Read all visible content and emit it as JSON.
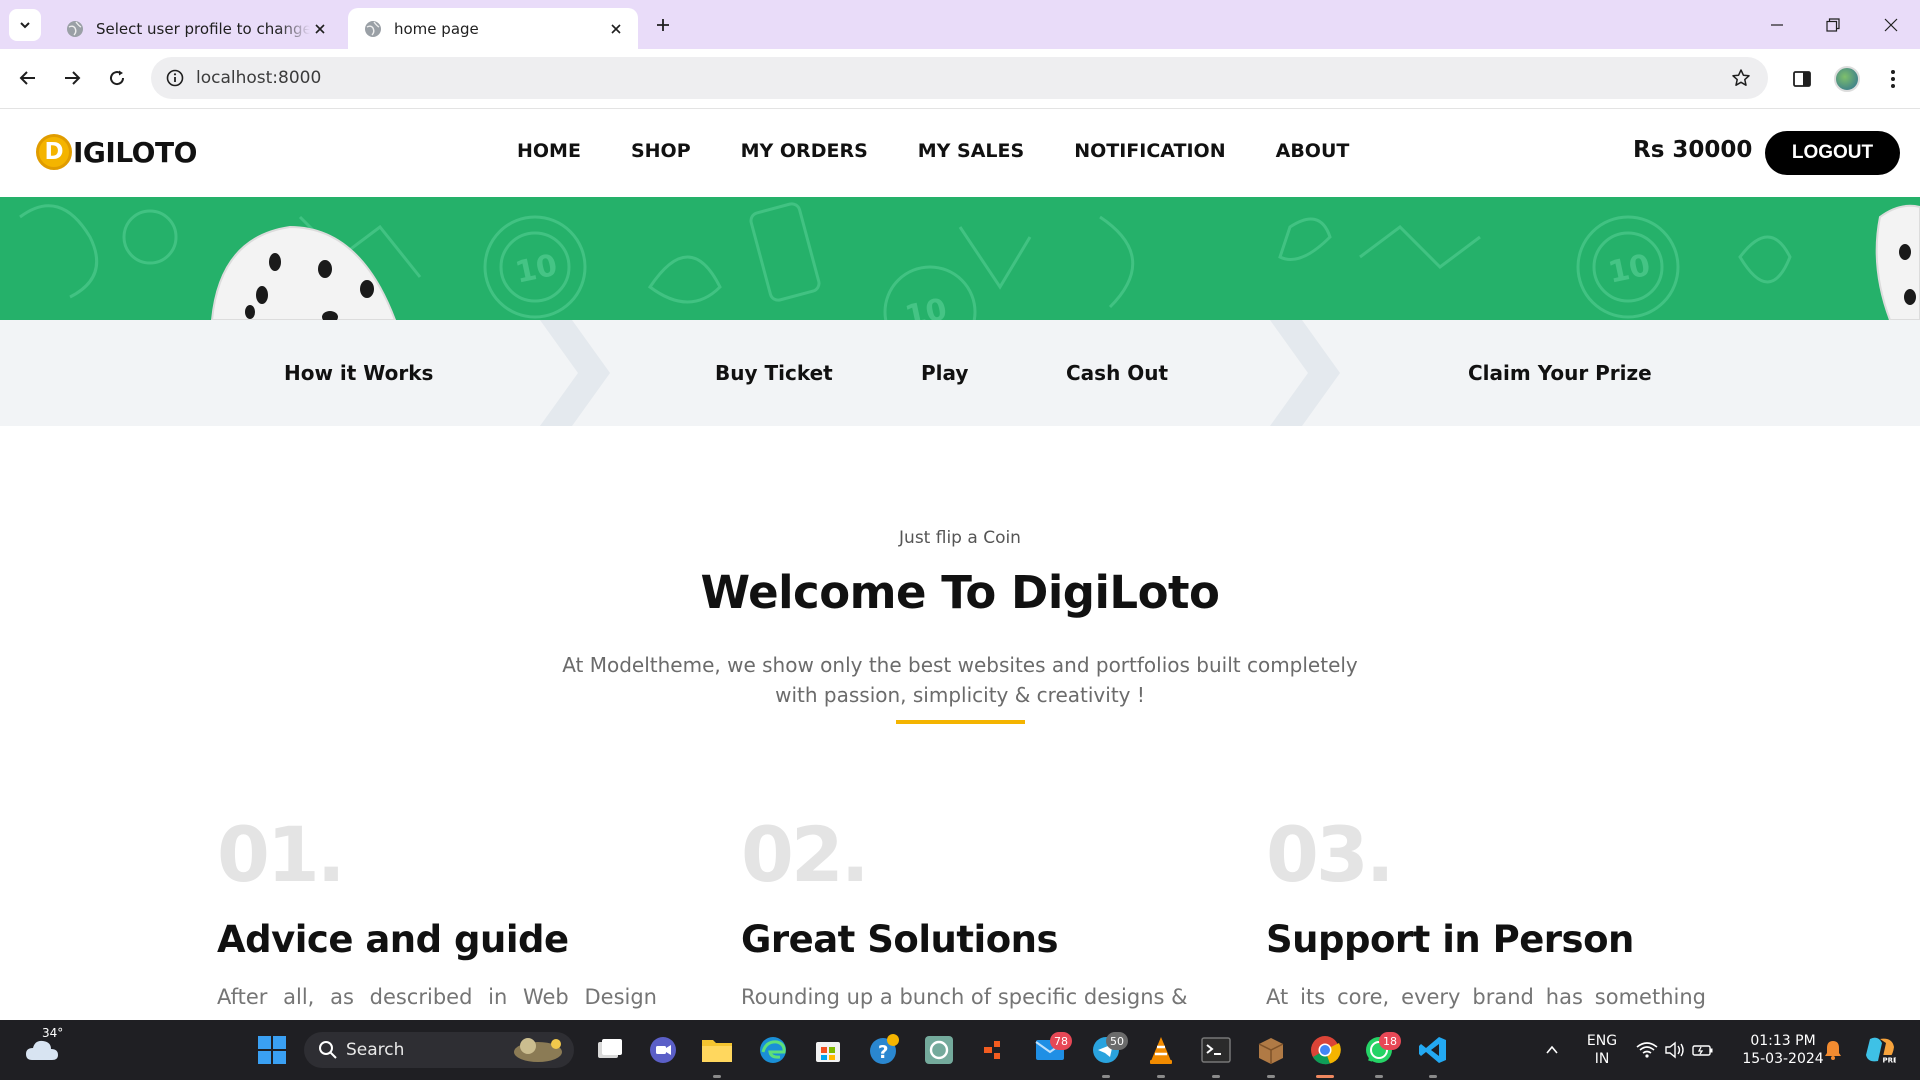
{
  "browser": {
    "tabs": [
      {
        "title": "Select user profile to change | D",
        "active": false
      },
      {
        "title": "home page",
        "active": true
      }
    ],
    "url": "localhost:8000"
  },
  "site": {
    "logo_letter": "D",
    "logo_text": "IGILOTO",
    "nav": [
      "HOME",
      "SHOP",
      "MY ORDERS",
      "MY SALES",
      "NOTIFICATION",
      "ABOUT"
    ],
    "balance": "Rs 30000",
    "logout_label": "LOGOUT"
  },
  "banner": {
    "color": "#25b16a"
  },
  "steps": [
    "How it Works",
    "Buy Ticket",
    "Play",
    "Cash Out",
    "Claim Your Prize"
  ],
  "hero": {
    "kicker": "Just flip a Coin",
    "title": "Welcome To DigiLoto",
    "lead": "At Modeltheme, we show only the best websites and portfolios built completely with passion, simplicity & creativity !",
    "accent_color": "#f4b400"
  },
  "features": [
    {
      "number": "01.",
      "title": "Advice and guide",
      "text": "After all, as described in Web Design"
    },
    {
      "number": "02.",
      "title": "Great Solutions",
      "text": "Rounding up a bunch of specific designs &"
    },
    {
      "number": "03.",
      "title": "Support in Person",
      "text": "At its core, every brand has something"
    }
  ],
  "taskbar": {
    "weather": "34°",
    "search_label": "Search",
    "badges": {
      "mail": "78",
      "telegram": "50",
      "whatsapp": "18"
    },
    "lang_top": "ENG",
    "lang_bottom": "IN",
    "time": "01:13 PM",
    "date": "15-03-2024"
  }
}
